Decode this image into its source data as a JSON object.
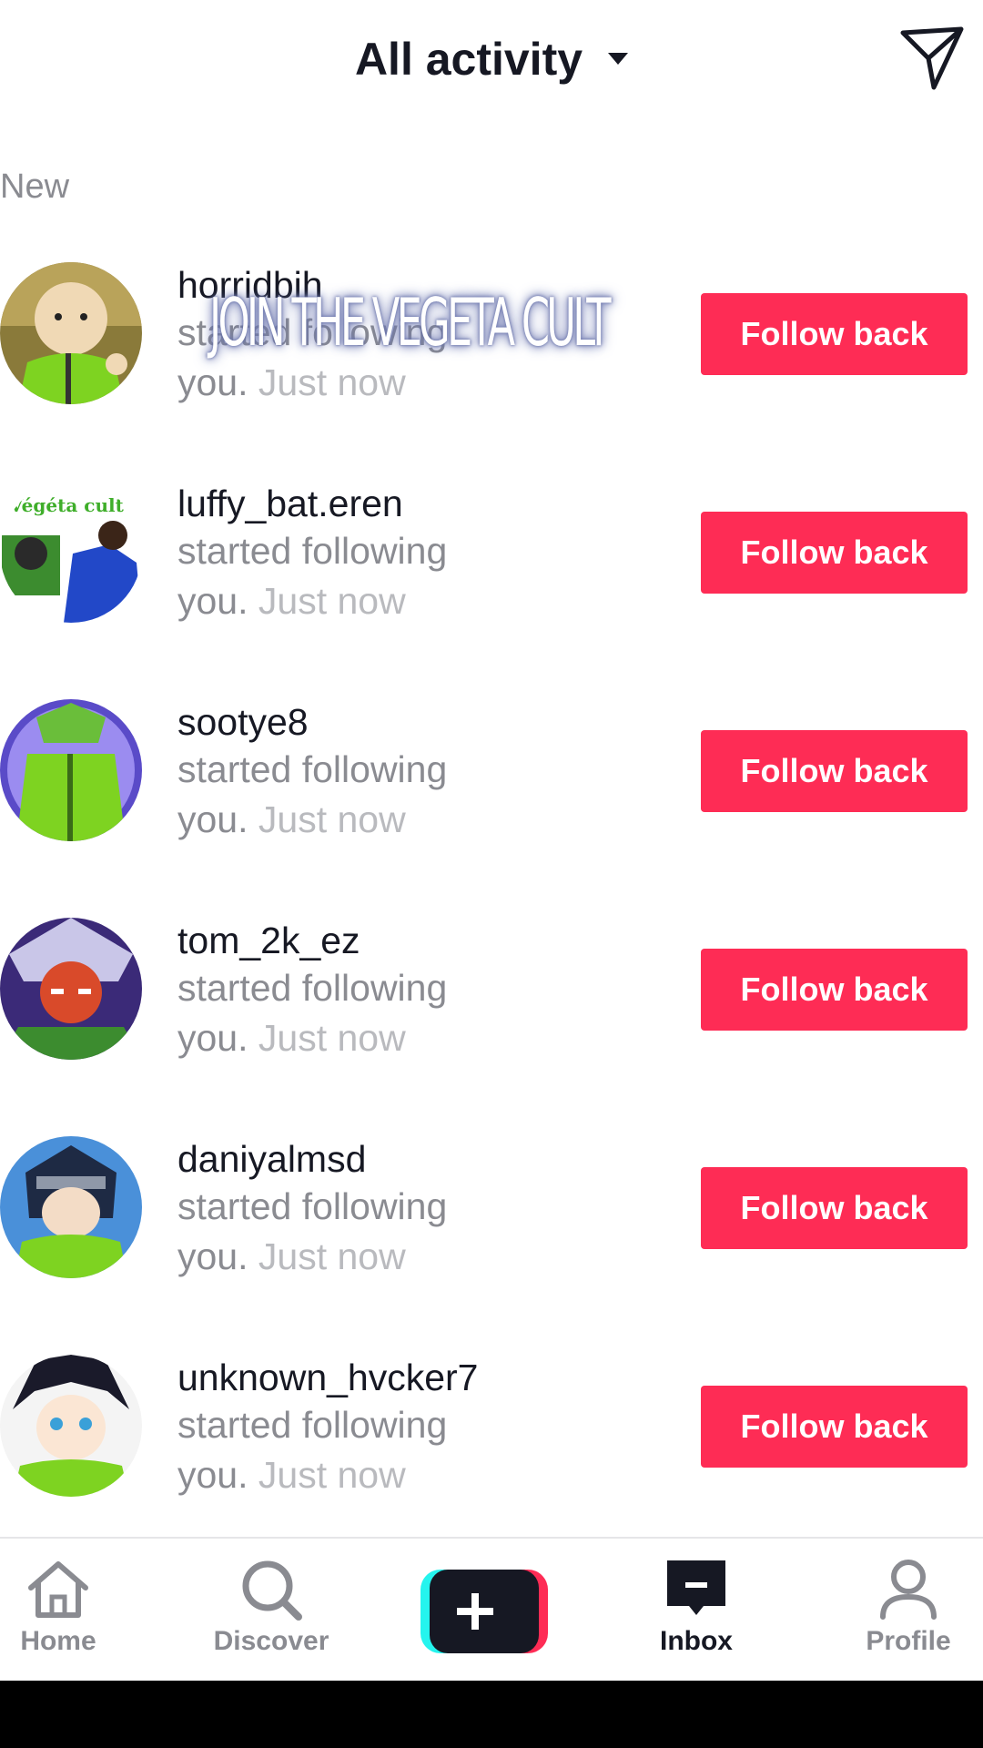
{
  "header": {
    "title": "All activity",
    "send_icon": "send-icon"
  },
  "section_label": "New",
  "overlay_caption": "JOIN THE VEGETA CULT",
  "notifications": [
    {
      "username": "horridbih",
      "action": "started following",
      "you": "you.",
      "time": "Just now",
      "button": "Follow back"
    },
    {
      "username": "luffy_bat.eren",
      "action": "started following",
      "you": "you.",
      "time": "Just now",
      "button": "Follow back",
      "avatar_text": "Végéta cult"
    },
    {
      "username": "sootye8",
      "action": "started following",
      "you": "you.",
      "time": "Just now",
      "button": "Follow back"
    },
    {
      "username": "tom_2k_ez",
      "action": "started following",
      "you": "you.",
      "time": "Just now",
      "button": "Follow back"
    },
    {
      "username": "daniyalmsd",
      "action": "started following",
      "you": "you.",
      "time": "Just now",
      "button": "Follow back"
    },
    {
      "username": "unknown_hvcker7",
      "action": "started following",
      "you": "you.",
      "time": "Just now",
      "button": "Follow back"
    }
  ],
  "nav": {
    "home": "Home",
    "discover": "Discover",
    "inbox": "Inbox",
    "profile": "Profile",
    "active": "Inbox"
  },
  "colors": {
    "accent": "#fe2c55",
    "text_primary": "#161823",
    "text_secondary": "#8a8b91",
    "avatar_jacket": "#7ed321"
  }
}
